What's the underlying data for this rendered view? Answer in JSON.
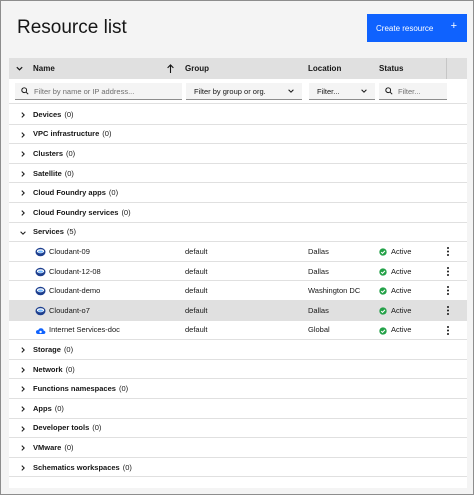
{
  "header": {
    "title": "Resource list",
    "create_button": "Create resource"
  },
  "table": {
    "columns": [
      {
        "label": "Name",
        "sort": "ascending"
      },
      {
        "label": "Group"
      },
      {
        "label": "Location"
      },
      {
        "label": "Status"
      }
    ],
    "filters": {
      "name_placeholder": "Filter by name or IP address...",
      "group_placeholder": "Filter by group or org.",
      "location_placeholder": "Filter...",
      "status_placeholder": "Filter..."
    },
    "groups_before": [
      {
        "name": "Devices",
        "count": "(0)"
      },
      {
        "name": "VPC infrastructure",
        "count": "(0)"
      },
      {
        "name": "Clusters",
        "count": "(0)"
      },
      {
        "name": "Satellite",
        "count": "(0)"
      },
      {
        "name": "Cloud Foundry apps",
        "count": "(0)"
      },
      {
        "name": "Cloud Foundry services",
        "count": "(0)"
      }
    ],
    "services_group": {
      "name": "Services",
      "count": "(5)",
      "expanded": true
    },
    "services": [
      {
        "name": "Cloudant-09",
        "group": "default",
        "location": "Dallas",
        "status": "Active",
        "icon": "cloudant-icon",
        "selected": false
      },
      {
        "name": "Cloudant-12-08",
        "group": "default",
        "location": "Dallas",
        "status": "Active",
        "icon": "cloudant-icon",
        "selected": false
      },
      {
        "name": "Cloudant-demo",
        "group": "default",
        "location": "Washington DC",
        "status": "Active",
        "icon": "cloudant-icon",
        "selected": false
      },
      {
        "name": "Cloudant-o7",
        "group": "default",
        "location": "Dallas",
        "status": "Active",
        "icon": "cloudant-icon",
        "selected": true
      },
      {
        "name": "Internet Services-doc",
        "group": "default",
        "location": "Global",
        "status": "Active",
        "icon": "internet-services-icon",
        "selected": false
      }
    ],
    "groups_after": [
      {
        "name": "Storage",
        "count": "(0)"
      },
      {
        "name": "Network",
        "count": "(0)"
      },
      {
        "name": "Functions namespaces",
        "count": "(0)"
      },
      {
        "name": "Apps",
        "count": "(0)"
      },
      {
        "name": "Developer tools",
        "count": "(0)"
      },
      {
        "name": "VMware",
        "count": "(0)"
      },
      {
        "name": "Schematics workspaces",
        "count": "(0)"
      }
    ]
  },
  "colors": {
    "primary": "#0f62fe",
    "active_status": "#24a148",
    "selected_row": "#e0e0e0",
    "header_bg": "#e0e0e0"
  }
}
